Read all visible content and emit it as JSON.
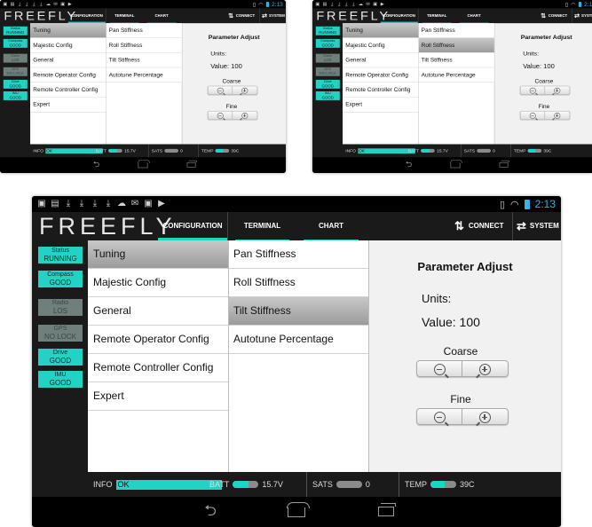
{
  "status_bar": {
    "notification_icons": [
      "▣",
      "▤",
      "⤓",
      "⤓",
      "⤓",
      "⤓",
      "☁",
      "✉",
      "▣",
      "▶"
    ],
    "time": "2:13"
  },
  "header": {
    "logo": "FREEFLY",
    "tabs": [
      "CONFIGURATION",
      "TERMINAL",
      "CHART"
    ],
    "connect_label": "CONNECT",
    "system_label": "SYSTEM"
  },
  "status_badges": [
    {
      "name": "Status",
      "value": "RUNNING",
      "active": true
    },
    {
      "name": "Compass",
      "value": "GOOD",
      "active": true
    },
    {
      "name": "Radio",
      "value": "LOS",
      "active": false
    },
    {
      "name": "GPS",
      "value": "NO LOCK",
      "active": false
    },
    {
      "name": "Drive",
      "value": "GOOD",
      "active": true
    },
    {
      "name": "IMU",
      "value": "GOOD",
      "active": true
    }
  ],
  "config_menu": [
    "Tuning",
    "Majestic Config",
    "General",
    "Remote Operator Config",
    "Remote Controller Config",
    "Expert"
  ],
  "tuning_menu": [
    "Pan Stiffness",
    "Roll Stiffness",
    "Tilt Stiffness",
    "Autotune Percentage"
  ],
  "screens": [
    {
      "id": "small-left",
      "selected_config": 0,
      "selected_tuning": -1
    },
    {
      "id": "small-right",
      "selected_config": 0,
      "selected_tuning": 1
    },
    {
      "id": "main",
      "selected_config": 0,
      "selected_tuning": 2
    }
  ],
  "parameter": {
    "title": "Parameter Adjust",
    "units_label": "Units:",
    "value_label": "Value: 100",
    "coarse_label": "Coarse",
    "fine_label": "Fine"
  },
  "footer": {
    "info_label": "INFO",
    "info_value": "OK",
    "batt_label": "BATT",
    "batt_value": "15.7V",
    "batt_fill": 0.6,
    "sats_label": "SATS",
    "sats_value": "0",
    "sats_fill": 0,
    "temp_label": "TEMP",
    "temp_value": "39C",
    "temp_fill": 0.55
  },
  "nav": {
    "back": "⮌"
  },
  "colors": {
    "accent": "#22d3c5",
    "header": "#1a1a1a",
    "selected": "#a9a9a9"
  }
}
